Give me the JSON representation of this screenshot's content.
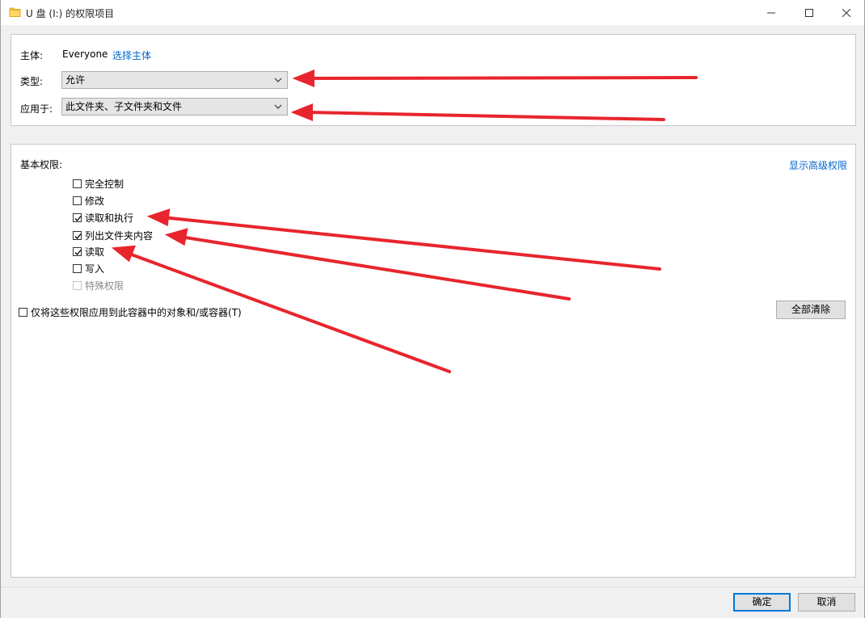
{
  "window": {
    "title": "U 盘 (I:) 的权限项目"
  },
  "principal": {
    "label": "主体:",
    "value": "Everyone",
    "select_link": "选择主体"
  },
  "type": {
    "label": "类型:",
    "value": "允许"
  },
  "applies_to": {
    "label": "应用于:",
    "value": "此文件夹、子文件夹和文件"
  },
  "basic_permissions": {
    "heading": "基本权限:",
    "advanced_link": "显示高级权限",
    "items": [
      {
        "label": "完全控制",
        "checked": false,
        "disabled": false
      },
      {
        "label": "修改",
        "checked": false,
        "disabled": false
      },
      {
        "label": "读取和执行",
        "checked": true,
        "disabled": false
      },
      {
        "label": "列出文件夹内容",
        "checked": true,
        "disabled": false
      },
      {
        "label": "读取",
        "checked": true,
        "disabled": false
      },
      {
        "label": "写入",
        "checked": false,
        "disabled": false
      },
      {
        "label": "特殊权限",
        "checked": false,
        "disabled": true
      }
    ],
    "apply_only_label": "仅将这些权限应用到此容器中的对象和/或容器(T)",
    "clear_all_button": "全部清除"
  },
  "footer": {
    "ok_button": "确定",
    "cancel_button": "取消"
  },
  "colors": {
    "link": "#0066cc",
    "annotation_arrow": "#e8252d",
    "default_button_border": "#0078d7"
  },
  "icons": [
    "folder-icon",
    "minimize-icon",
    "maximize-icon",
    "close-icon",
    "chevron-down-icon",
    "checkbox-icon",
    "annotation-arrow"
  ]
}
